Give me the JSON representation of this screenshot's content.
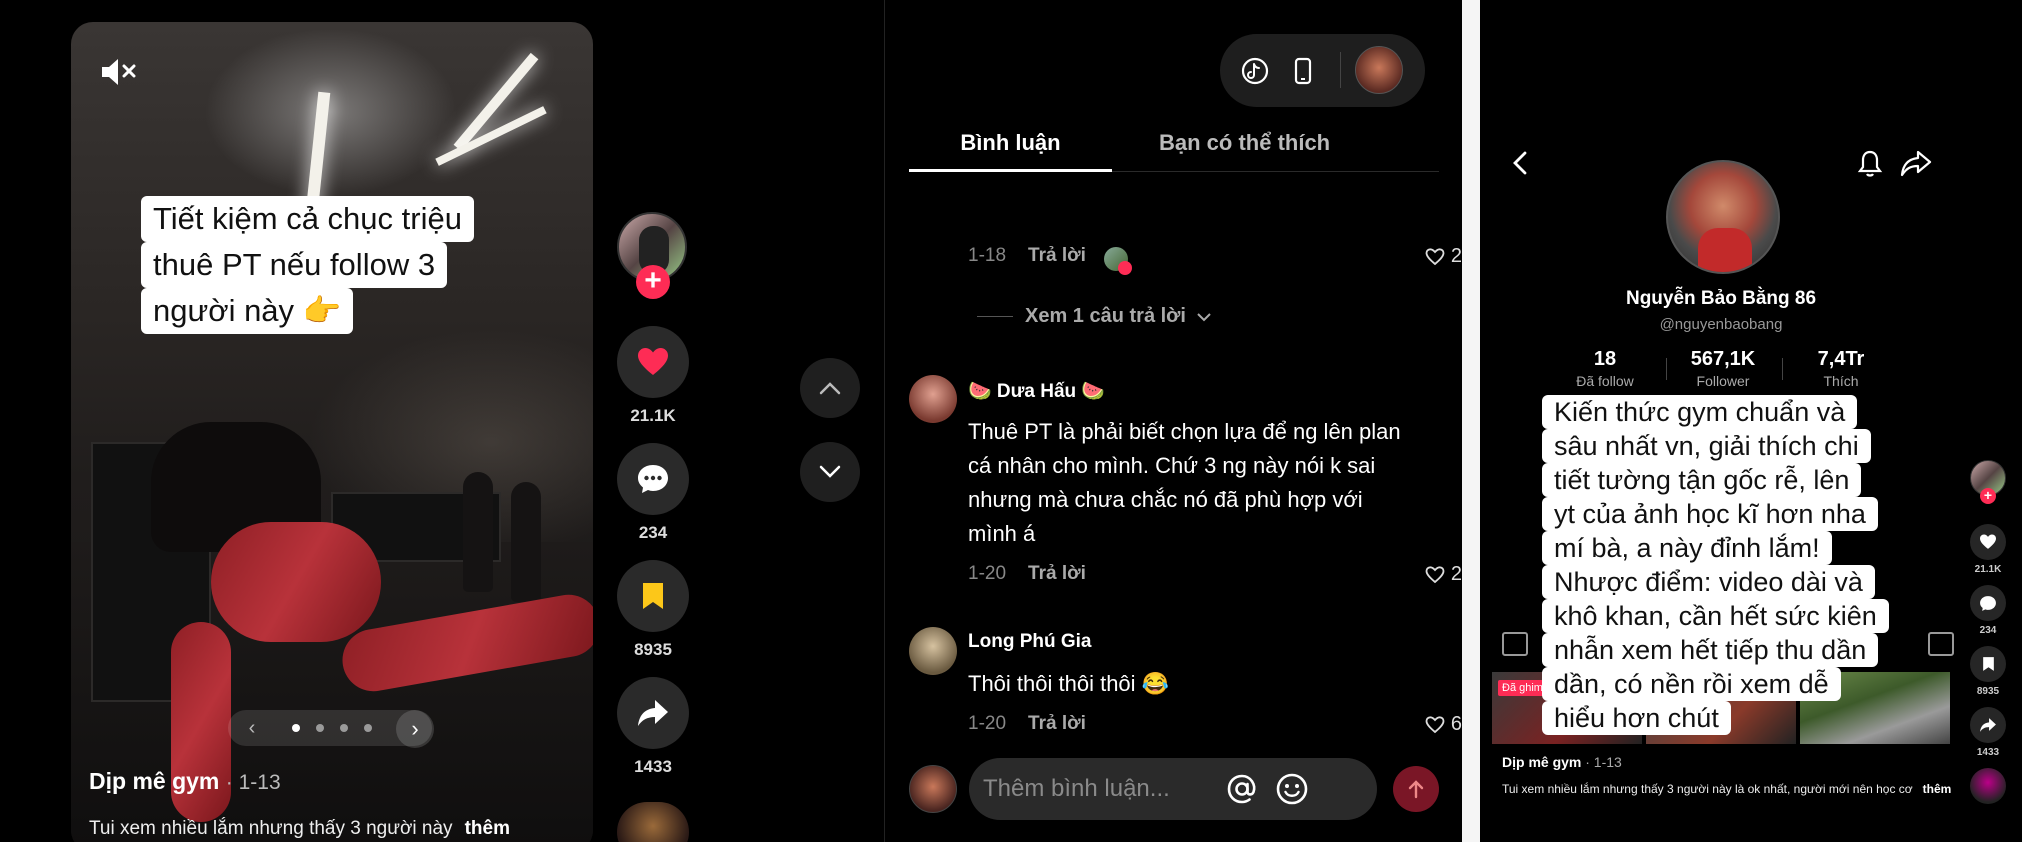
{
  "feed": {
    "caption_lines": [
      "Tiết kiệm cả chục triệu",
      "thuê PT nếu follow 3",
      "người này 👉"
    ],
    "title": "Dịp mê gym",
    "date": "· 1-13",
    "description": "Tui xem nhiều lắm nhưng thấy 3 người này",
    "more_label": "thêm",
    "actions": {
      "likes": "21.1K",
      "comments": "234",
      "saves": "8935",
      "shares": "1433"
    },
    "carousel": {
      "slides": 4,
      "active_index": 0
    },
    "follow_plus": "+",
    "like_color": "#fe2c55",
    "save_color": "#fcc719"
  },
  "comments_panel": {
    "tabs": [
      {
        "label": "Bình luận",
        "active": true
      },
      {
        "label": "Bạn có thể thích",
        "active": false
      }
    ],
    "first_reply_meta": {
      "date": "1-18",
      "reply_label": "Trả lời",
      "likes": "2"
    },
    "view_replies_label": "Xem 1 câu trả lời",
    "comments": [
      {
        "author": "🍉 Dưa Hấu 🍉",
        "text_lines": [
          "Thuê PT là phải biết chọn lựa để ng lên plan",
          "cá nhân cho mình. Chứ 3 ng này nói k sai",
          "nhưng mà chưa chắc nó đã phù hợp với",
          "mình á"
        ],
        "date": "1-20",
        "reply_label": "Trả lời",
        "likes": "2"
      },
      {
        "author": "Long Phú Gia",
        "text_lines": [
          "Thôi thôi thôi thôi 😂"
        ],
        "date": "1-20",
        "reply_label": "Trả lời",
        "likes": "6"
      }
    ],
    "composer": {
      "placeholder": "Thêm bình luận..."
    },
    "accent": "#7a1626"
  },
  "mobile": {
    "name": "Nguyễn Bảo Bằng 86",
    "handle": "@nguyenbaobang",
    "stats": [
      {
        "value": "18",
        "label": "Đã follow"
      },
      {
        "value": "567,1K",
        "label": "Follower"
      },
      {
        "value": "7,4Tr",
        "label": "Thích"
      }
    ],
    "caption_lines": [
      "Kiến thức gym chuẩn và",
      "sâu nhất vn, giải thích chi",
      "tiết tường tận gốc rễ, lên",
      "yt của ảnh học kĩ hơn nha",
      "mí bà, a này đỉnh lắm!",
      "Nhược điểm: video dài và",
      "khô khan, cần hết sức kiên",
      "nhẫn xem hết tiếp thu dần",
      "dần, có nền rồi xem dễ",
      "hiểu hơn chút"
    ],
    "pinned_label": "Đã ghim",
    "title": "Dịp mê gym",
    "date": "· 1-13",
    "description": "Tui xem nhiều lắm nhưng thấy 3 người này là ok nhất, người mới nên học cơ",
    "more_label": "thêm",
    "actions": {
      "likes": "21.1K",
      "comments": "234",
      "saves": "8935",
      "shares": "1433"
    }
  }
}
